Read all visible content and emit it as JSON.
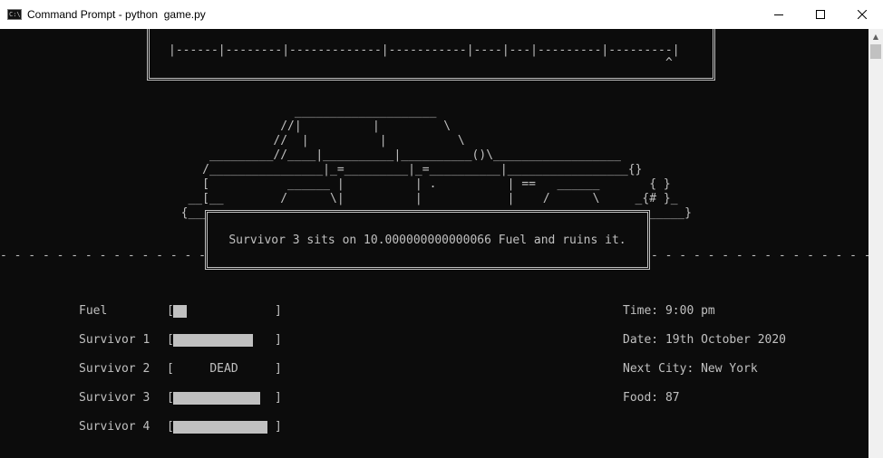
{
  "window": {
    "title": "Command Prompt - python  game.py",
    "icon_text": "C:\\"
  },
  "map": {
    "road": "|------|--------|-------------|-----------|----|---|---------|---------|",
    "marker": "^"
  },
  "car_ascii": "                  ____________________\n                //|          |         \\\n               //  |          |          \\\n      _________//____|__________|__________()\\__________________\n     /________________|_=_________|_=__________|_________________{}\n     [           ______ |          | .          | ==   ______       { }\n   __[__        /      \\|          |            |    /      \\     _{# }_\n  {_____",
  "car_right_end": "_____}",
  "dashes": {
    "left": "- - - - - - - - - - - - - - - - - - - - - - - - - -",
    "right": "- - - - - - - - - - - - - - - - - - - - - - - - - - - -"
  },
  "message": "Survivor 3 sits on 10.000000000000066 Fuel and ruins it.",
  "stats": [
    {
      "label": "Fuel",
      "level": 0.13,
      "dead": false
    },
    {
      "label": "Survivor 1",
      "level": 0.79,
      "dead": false
    },
    {
      "label": "Survivor 2",
      "level": 0,
      "dead": true,
      "status": "DEAD"
    },
    {
      "label": "Survivor 3",
      "level": 0.86,
      "dead": false
    },
    {
      "label": "Survivor 4",
      "level": 0.93,
      "dead": false
    }
  ],
  "bracket_open": "[",
  "bracket_close": "]",
  "info": {
    "time": "Time: 9:00 pm",
    "date": "Date: 19th October 2020",
    "next_city": "Next City: New York",
    "food": "Food: 87"
  },
  "colors": {
    "console_bg": "#0c0c0c",
    "console_text": "#c0c0c0"
  }
}
